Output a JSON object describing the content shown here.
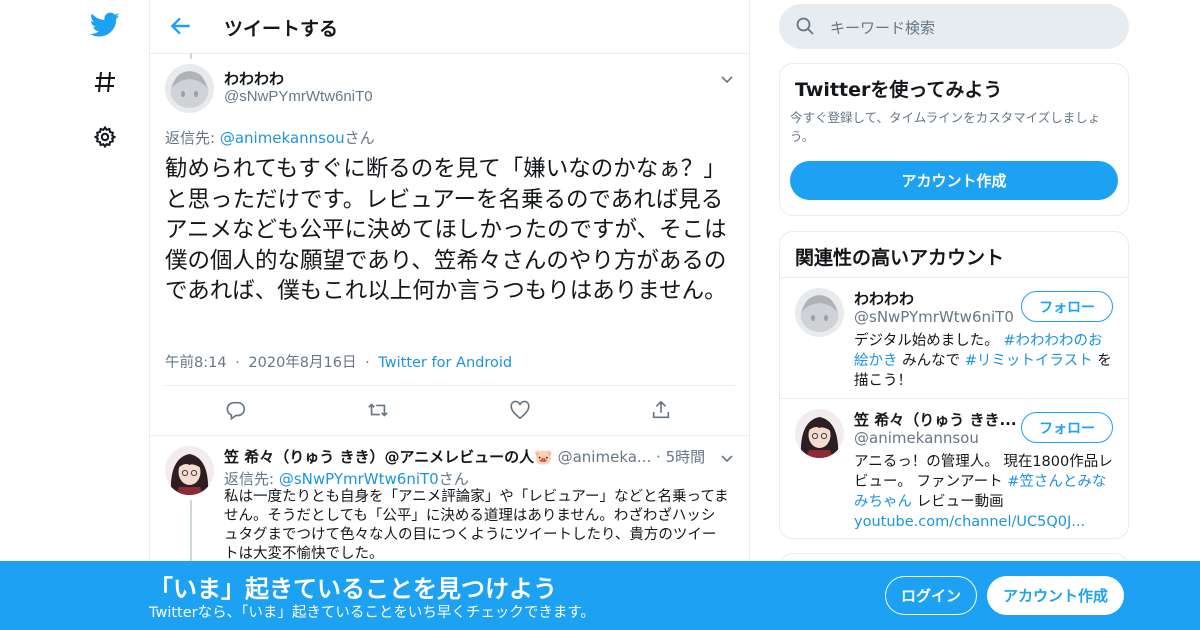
{
  "header": {
    "title": "ツイートする"
  },
  "tweet": {
    "name": "わわわわ",
    "handle": "@sNwPYmrWtw6niT0",
    "reply_prefix": "返信先: ",
    "reply_to": "@animekannsou",
    "reply_suffix": "さん",
    "text": "勧められてもすぐに断るのを見て「嫌いなのかなぁ？」と思っただけです。レビュアーを名乗るのであれば見るアニメなども公平に決めてほしかったのですが、そこは僕の個人的な願望であり、笠希々さんのやり方があるのであれば、僕もこれ以上何か言うつもりはありません。",
    "time": "午前8:14",
    "date": "2020年8月16日",
    "source": "Twitter for Android",
    "dot": "·"
  },
  "reply": {
    "name": "笠 希々（りゅう きき）@アニメレビューの人🐷",
    "handle": "@animeka...",
    "dot": " · ",
    "time": "5時間",
    "reply_prefix": "返信先: ",
    "reply_to": "@sNwPYmrWtw6niT0",
    "reply_suffix": "さん",
    "text": "私は一度たりとも自身を「アニメ評論家」や「レビュアー」などと名乗ってません。そうだとしても「公平」に決める道理はありません。わざわざハッシュタグまでつけて色々な人の目につくようにツイートしたり、貴方のツイートは大変不愉快でした。"
  },
  "search": {
    "placeholder": "キーワード検索"
  },
  "signup_card": {
    "title": "Twitterを使ってみよう",
    "description": "今すぐ登録して、タイムラインをカスタマイズしましょう。",
    "button": "アカウント作成"
  },
  "related": {
    "title": "関連性の高いアカウント",
    "follow_label": "フォロー",
    "accounts": [
      {
        "name": "わわわわ",
        "handle": "@sNwPYmrWtw6niT0",
        "bio_text1": "デジタル始めました。",
        "bio_tag1": "#わわわわのお絵かき",
        "bio_text2": " みんなで ",
        "bio_tag2": "#リミットイラスト",
        "bio_text3": "を描こう！"
      },
      {
        "name": "笠 希々（りゅう きき...",
        "handle": "@animekannsou",
        "bio_text1": "アニるっ！の管理人。 現在1800作品レビュー。 ファンアート ",
        "bio_tag1": "#笠さんとみなみちゃん",
        "bio_text2": " レビュー動画 ",
        "bio_link": "youtube.com/channel/UC5Q0J..."
      }
    ]
  },
  "banner": {
    "title": "「いま」起きていることを見つけよう",
    "subtitle": "Twitterなら、「いま」起きていることをいち早くチェックできます。",
    "login": "ログイン",
    "signup": "アカウント作成"
  },
  "colors": {
    "accent": "#1da1f2",
    "link": "#1b95e0",
    "muted": "#657786",
    "border": "#e6ecf0"
  }
}
